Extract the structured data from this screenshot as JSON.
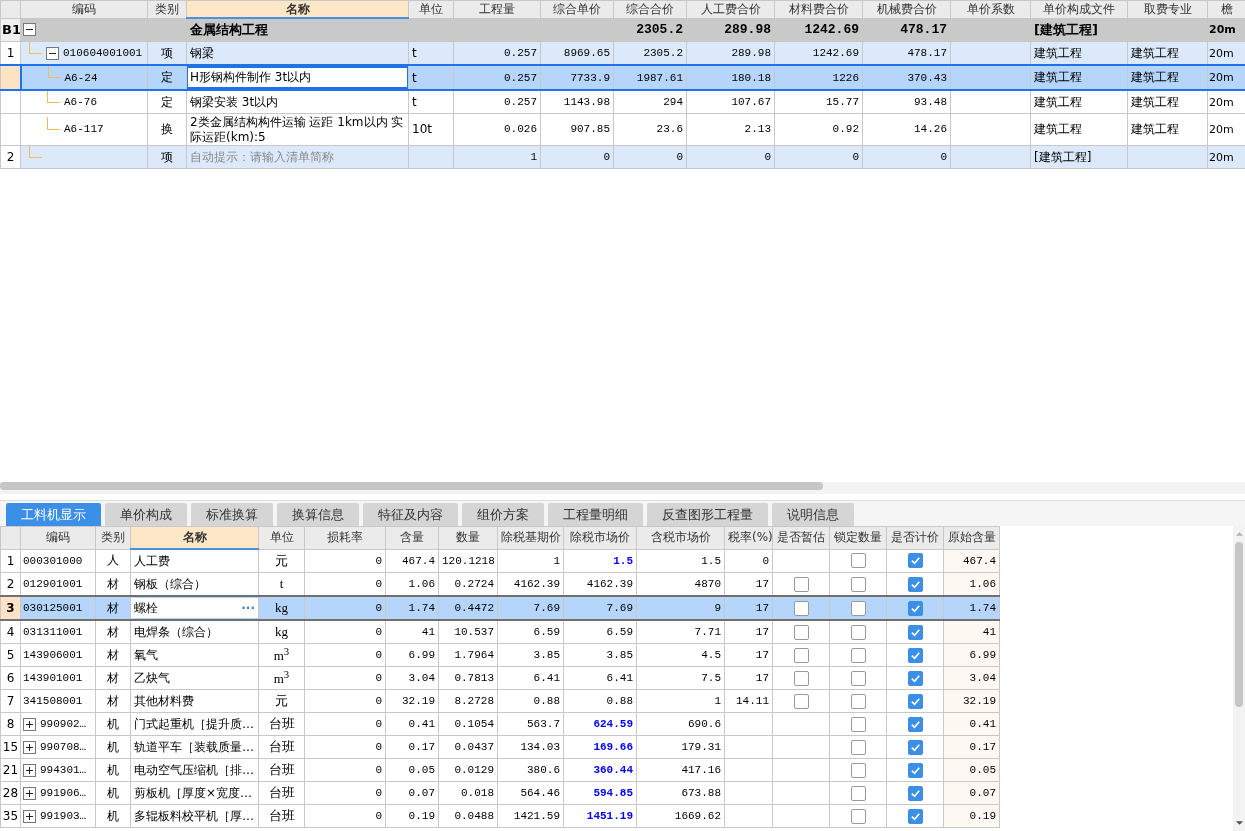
{
  "top_table": {
    "columns": [
      "编码",
      "类别",
      "名称",
      "单位",
      "工程量",
      "综合单价",
      "综合合价",
      "人工费合价",
      "材料费合价",
      "机械费合价",
      "单价系数",
      "单价构成文件",
      "取费专业",
      "檐"
    ],
    "rows": [
      {
        "kind": "section",
        "number": "B1",
        "expanded": true,
        "selected": false,
        "cells": [
          "",
          "",
          "金属结构工程",
          "",
          "",
          "",
          "2305.2",
          "289.98",
          "1242.69",
          "478.17",
          "",
          "[建筑工程]",
          "",
          "20m"
        ],
        "children": [
          {
            "kind": "item",
            "number": "1",
            "expanded": true,
            "selected": false,
            "cells": [
              "010604001001",
              "项",
              "钢梁",
              "t",
              "0.257",
              "8969.65",
              "2305.2",
              "289.98",
              "1242.69",
              "478.17",
              "",
              "建筑工程",
              "建筑工程",
              "20m"
            ],
            "children": [
              {
                "kind": "quota",
                "selected": true,
                "cells": [
                  "A6-24",
                  "定",
                  "H形钢构件制作 3t以内",
                  "t",
                  "0.257",
                  "7733.9",
                  "1987.61",
                  "180.18",
                  "1226",
                  "370.43",
                  "",
                  "建筑工程",
                  "建筑工程",
                  "20m"
                ]
              },
              {
                "kind": "quota",
                "selected": false,
                "cells": [
                  "A6-76",
                  "定",
                  "钢梁安装 3t以内",
                  "t",
                  "0.257",
                  "1143.98",
                  "294",
                  "107.67",
                  "15.77",
                  "93.48",
                  "",
                  "建筑工程",
                  "建筑工程",
                  "20m"
                ]
              },
              {
                "kind": "quota",
                "selected": false,
                "cells": [
                  "A6-117",
                  "换",
                  "2类金属结构构件运输 运距 1km以内  实际运距(km):5",
                  "10t",
                  "0.026",
                  "907.85",
                  "23.6",
                  "2.13",
                  "0.92",
                  "14.26",
                  "",
                  "建筑工程",
                  "建筑工程",
                  "20m"
                ]
              }
            ]
          },
          {
            "kind": "item",
            "number": "2",
            "selected": false,
            "placeholder": "自动提示：请输入清单简称",
            "cells": [
              "",
              "项",
              "",
              "",
              "1",
              "0",
              "0",
              "0",
              "0",
              "0",
              "",
              "[建筑工程]",
              "",
              "20m"
            ]
          }
        ]
      }
    ]
  },
  "tabs": [
    {
      "label": "工料机显示",
      "selected": true
    },
    {
      "label": "单价构成",
      "selected": false
    },
    {
      "label": "标准换算",
      "selected": false
    },
    {
      "label": "换算信息",
      "selected": false
    },
    {
      "label": "特征及内容",
      "selected": false
    },
    {
      "label": "组价方案",
      "selected": false
    },
    {
      "label": "工程量明细",
      "selected": false
    },
    {
      "label": "反查图形工程量",
      "selected": false
    },
    {
      "label": "说明信息",
      "selected": false
    }
  ],
  "resource_table": {
    "columns": [
      "",
      "编码",
      "类别",
      "名称",
      "单位",
      "损耗率",
      "含量",
      "数量",
      "除税基期价",
      "除税市场价",
      "含税市场价",
      "税率(%)",
      "是否暂估",
      "锁定数量",
      "是否计价",
      "原始含量"
    ],
    "rows": [
      {
        "number": "1",
        "code": "000301000",
        "category": "人",
        "name": "人工费",
        "unit": "元",
        "loss_rate": "0",
        "content": "467.4",
        "quantity": "120.1218",
        "base_price": "1",
        "market_price": "1.5",
        "price_adjusted": true,
        "tax_price": "1.5",
        "tax_rate": "0",
        "locked": false,
        "priced": true,
        "original_content": "467.4",
        "selected": false
      },
      {
        "number": "2",
        "code": "012901001",
        "category": "材",
        "name": "钢板（综合）",
        "unit": "t",
        "loss_rate": "0",
        "content": "1.06",
        "quantity": "0.2724",
        "base_price": "4162.39",
        "market_price": "4162.39",
        "price_adjusted": false,
        "tax_price": "4870",
        "tax_rate": "17",
        "provisional": false,
        "locked": false,
        "priced": true,
        "original_content": "1.06",
        "selected": false
      },
      {
        "number": "3",
        "code": "030125001",
        "category": "材",
        "name": "螺栓",
        "edit_button": "···",
        "unit": "kg",
        "loss_rate": "0",
        "content": "1.74",
        "quantity": "0.4472",
        "base_price": "7.69",
        "market_price": "7.69",
        "price_adjusted": false,
        "tax_price": "9",
        "tax_rate": "17",
        "provisional": false,
        "locked": false,
        "priced": true,
        "original_content": "1.74",
        "selected": true
      },
      {
        "number": "4",
        "code": "031311001",
        "category": "材",
        "name": "电焊条（综合）",
        "unit": "kg",
        "loss_rate": "0",
        "content": "41",
        "quantity": "10.537",
        "base_price": "6.59",
        "market_price": "6.59",
        "price_adjusted": false,
        "tax_price": "7.71",
        "tax_rate": "17",
        "provisional": false,
        "locked": false,
        "priced": true,
        "original_content": "41",
        "selected": false
      },
      {
        "number": "5",
        "code": "143906001",
        "category": "材",
        "name": "氧气",
        "unit": "m$^{3}$",
        "loss_rate": "0",
        "content": "6.99",
        "quantity": "1.7964",
        "base_price": "3.85",
        "market_price": "3.85",
        "price_adjusted": false,
        "tax_price": "4.5",
        "tax_rate": "17",
        "provisional": false,
        "locked": false,
        "priced": true,
        "original_content": "6.99",
        "selected": false
      },
      {
        "number": "6",
        "code": "143901001",
        "category": "材",
        "name": "乙炔气",
        "unit": "m$^{3}$",
        "loss_rate": "0",
        "content": "3.04",
        "quantity": "0.7813",
        "base_price": "6.41",
        "market_price": "6.41",
        "price_adjusted": false,
        "tax_price": "7.5",
        "tax_rate": "17",
        "provisional": false,
        "locked": false,
        "priced": true,
        "original_content": "3.04",
        "selected": false
      },
      {
        "number": "7",
        "code": "341508001",
        "category": "材",
        "name": "其他材料费",
        "unit": "元",
        "loss_rate": "0",
        "content": "32.19",
        "quantity": "8.2728",
        "base_price": "0.88",
        "market_price": "0.88",
        "price_adjusted": false,
        "tax_price": "1",
        "tax_rate": "14.11",
        "provisional": false,
        "locked": false,
        "priced": true,
        "original_content": "32.19",
        "selected": false
      },
      {
        "number": "8",
        "expanded": false,
        "code": "990902…",
        "category": "机",
        "name": "门式起重机［提升质…",
        "unit": "台班",
        "loss_rate": "0",
        "content": "0.41",
        "quantity": "0.1054",
        "base_price": "563.7",
        "market_price": "624.59",
        "price_adjusted": true,
        "tax_price": "690.6",
        "locked": false,
        "priced": true,
        "original_content": "0.41",
        "selected": false
      },
      {
        "number": "15",
        "expanded": false,
        "code": "990708…",
        "category": "机",
        "name": "轨道平车［装载质量…",
        "unit": "台班",
        "loss_rate": "0",
        "content": "0.17",
        "quantity": "0.0437",
        "base_price": "134.03",
        "market_price": "169.66",
        "price_adjusted": true,
        "tax_price": "179.31",
        "locked": false,
        "priced": true,
        "original_content": "0.17",
        "selected": false
      },
      {
        "number": "21",
        "expanded": false,
        "code": "994301…",
        "category": "机",
        "name": "电动空气压缩机［排…",
        "unit": "台班",
        "loss_rate": "0",
        "content": "0.05",
        "quantity": "0.0129",
        "base_price": "380.6",
        "market_price": "360.44",
        "price_adjusted": true,
        "tax_price": "417.16",
        "locked": false,
        "priced": true,
        "original_content": "0.05",
        "selected": false
      },
      {
        "number": "28",
        "expanded": false,
        "code": "991906…",
        "category": "机",
        "name": "剪板机［厚度×宽度…",
        "unit": "台班",
        "loss_rate": "0",
        "content": "0.07",
        "quantity": "0.018",
        "base_price": "564.46",
        "market_price": "594.85",
        "price_adjusted": true,
        "tax_price": "673.88",
        "locked": false,
        "priced": true,
        "original_content": "0.07",
        "selected": false
      },
      {
        "number": "35",
        "expanded": false,
        "code": "991903…",
        "category": "机",
        "name": "多辊板料校平机［厚…",
        "unit": "台班",
        "loss_rate": "0",
        "content": "0.19",
        "quantity": "0.0488",
        "base_price": "1421.59",
        "market_price": "1451.19",
        "price_adjusted": true,
        "tax_price": "1669.62",
        "locked": false,
        "priced": true,
        "original_content": "0.19",
        "selected": false
      }
    ]
  }
}
